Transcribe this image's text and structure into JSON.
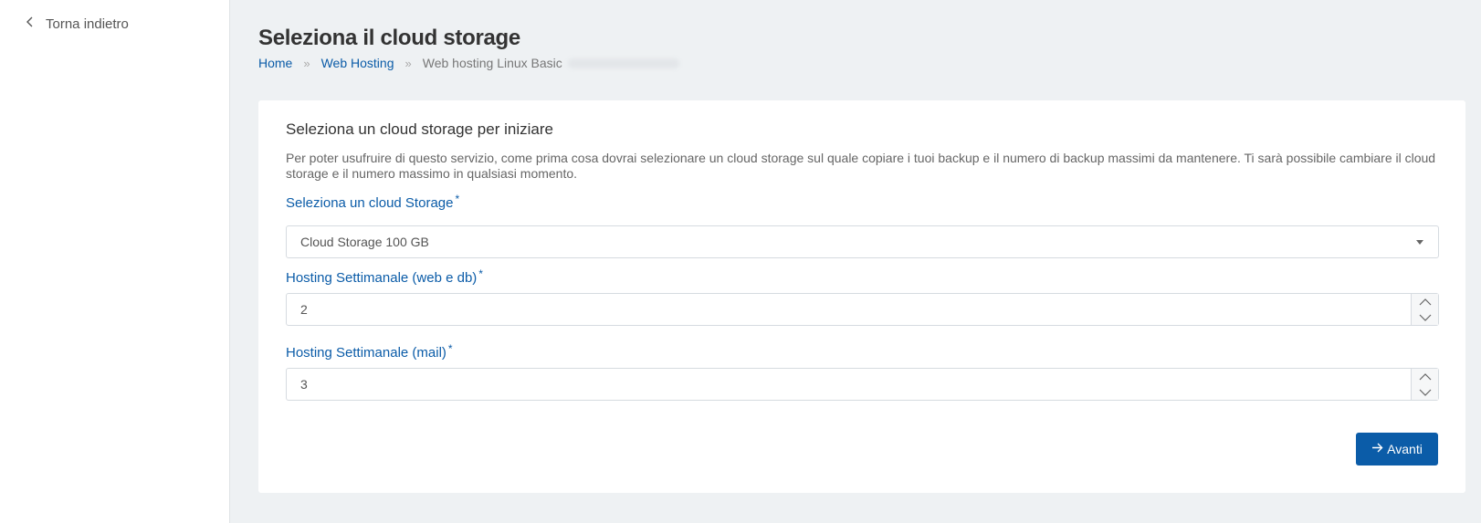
{
  "sidebar": {
    "back_label": "Torna indietro"
  },
  "header": {
    "title": "Seleziona il cloud storage",
    "breadcrumb": {
      "home": "Home",
      "separator": "»",
      "web_hosting": "Web Hosting",
      "current": "Web hosting Linux Basic"
    }
  },
  "card": {
    "title": "Seleziona un cloud storage per iniziare",
    "description": "Per poter usufruire di questo servizio, come prima cosa dovrai selezionare un cloud storage sul quale copiare i tuoi backup e il numero di backup massimi da mantenere. Ti sarà possibile cambiare il cloud storage e il numero massimo in qualsiasi momento.",
    "fields": {
      "storage": {
        "label": "Seleziona un cloud Storage",
        "required_mark": "*",
        "value": "Cloud Storage 100 GB"
      },
      "weekly_web_db": {
        "label": "Hosting Settimanale (web e db)",
        "required_mark": "*",
        "value": "2"
      },
      "weekly_mail": {
        "label": "Hosting Settimanale (mail)",
        "required_mark": "*",
        "value": "3"
      }
    },
    "next_button": "Avanti"
  },
  "colors": {
    "accent": "#0b5ca8",
    "background": "#eef1f3",
    "card": "#ffffff"
  },
  "icons": {
    "back": "chevron-left-icon",
    "caret": "caret-down-icon",
    "spin_up": "chevron-up-icon",
    "spin_down": "chevron-down-icon",
    "next": "arrow-right-icon"
  }
}
